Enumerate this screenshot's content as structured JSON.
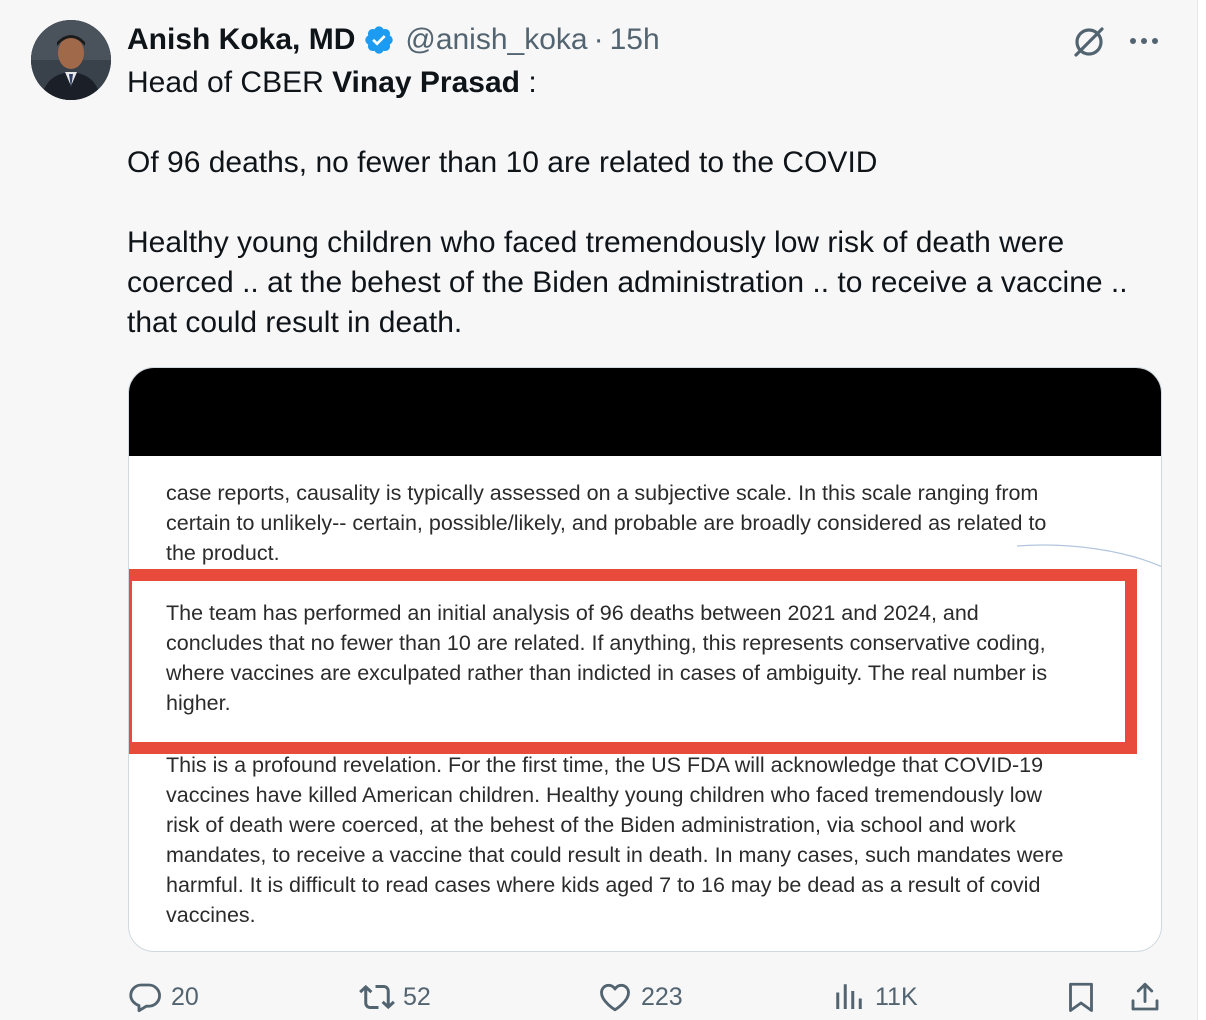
{
  "author": {
    "name": "Anish Koka, MD",
    "handle": "@anish_koka",
    "separator": "·",
    "time": "15h"
  },
  "icons": {
    "verified": "verified-badge-icon",
    "grok": "grok-icon",
    "more": "more-icon",
    "reply": "reply-icon",
    "repost": "repost-icon",
    "like": "like-icon",
    "views": "views-icon",
    "bookmark": "bookmark-icon",
    "share": "share-icon"
  },
  "tweet": {
    "line1_prefix": "Head of CBER ",
    "line1_bold": "Vinay Prasad",
    "line1_suffix": " :",
    "para2": "Of 96 deaths, no fewer than 10 are related to the COVID",
    "para3_line1": "Healthy young children who faced tremendously low risk of death were",
    "para3_line2": "coerced .. at the behest of the Biden administration .. to receive a vaccine ..",
    "para3_line3": "that could result in death."
  },
  "document": {
    "para1": [
      "case reports, causality is typically assessed on a subjective scale. In this scale ranging from",
      "certain to unlikely-- certain, possible/likely, and probable are broadly considered as related to",
      "the product."
    ],
    "para2": [
      "The team has performed an initial analysis of 96 deaths between 2021 and 2024, and",
      "concludes that no fewer than 10 are related. If anything, this represents conservative coding,",
      "where vaccines are exculpated rather than indicted in cases of ambiguity. The real number is",
      "higher."
    ],
    "para3": [
      "This is a profound revelation. For the first time, the US FDA will acknowledge that COVID-19",
      "vaccines have killed American children. Healthy young children who faced tremendously low",
      "risk of death were coerced, at the behest of the Biden administration, via school and work",
      "mandates, to receive a vaccine that could result in death. In many cases, such mandates were",
      "harmful. It is difficult to read cases where kids aged 7 to 16 may be dead as a result of covid",
      "vaccines."
    ]
  },
  "actions": {
    "replies": "20",
    "reposts": "52",
    "likes": "223",
    "views": "11K"
  },
  "colors": {
    "text": "#0f1419",
    "secondary": "#536471",
    "verified": "#1d9bf0",
    "highlight_border": "#e84a3b",
    "background": "#f7f7f8"
  }
}
